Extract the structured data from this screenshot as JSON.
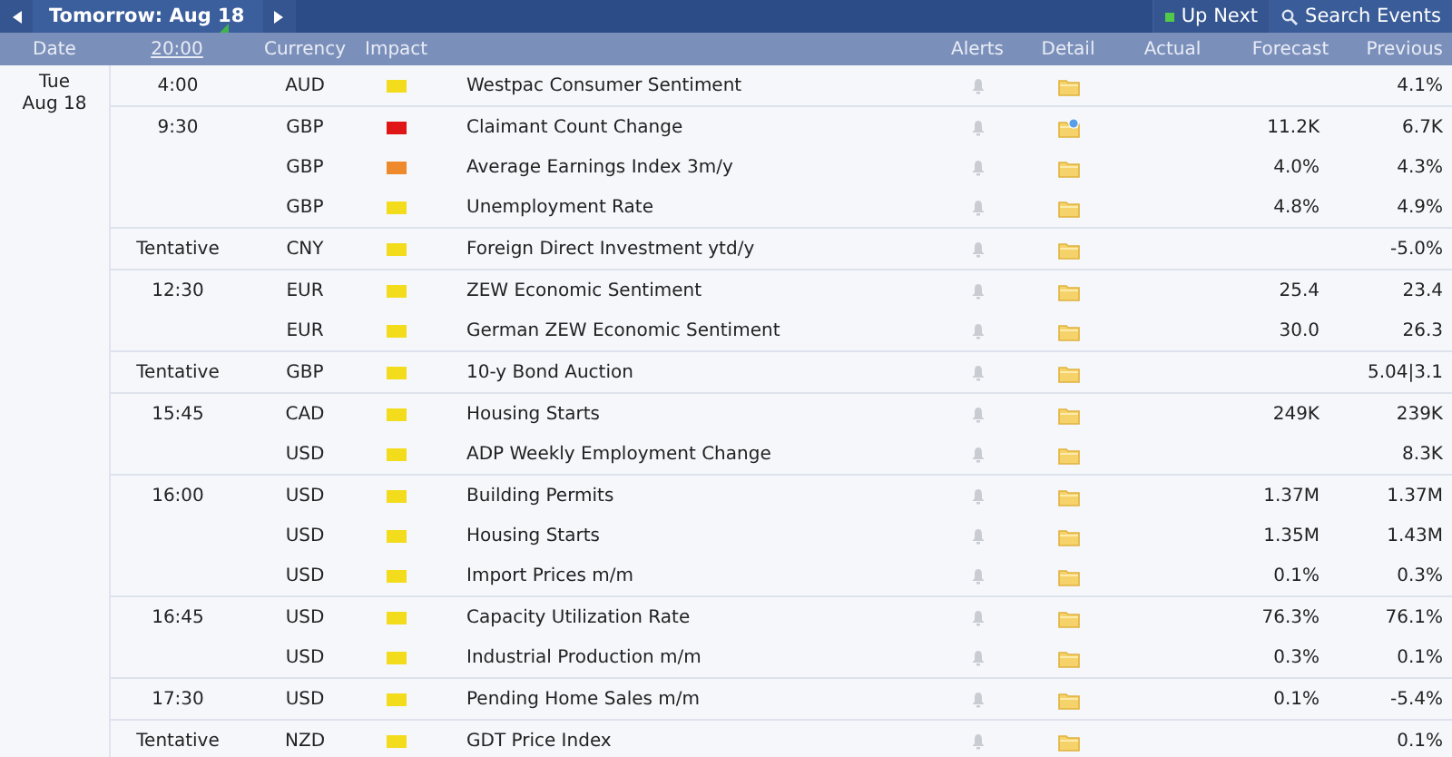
{
  "nav": {
    "title": "Tomorrow: Aug 18",
    "up_next": "Up Next",
    "search": "Search Events"
  },
  "columns": {
    "date": "Date",
    "time": "20:00",
    "currency": "Currency",
    "impact": "Impact",
    "alerts": "Alerts",
    "detail": "Detail",
    "actual": "Actual",
    "forecast": "Forecast",
    "previous": "Previous"
  },
  "day": {
    "weekday": "Tue",
    "date": "Aug 18"
  },
  "groups": [
    {
      "time": "4:00",
      "events": [
        {
          "currency": "AUD",
          "color": "#f3dc1c",
          "event": "Westpac Consumer Sentiment",
          "detail_updated": false,
          "previous": "4.1%"
        }
      ]
    },
    {
      "time": "9:30",
      "events": [
        {
          "currency": "GBP",
          "color": "#e01616",
          "event": "Claimant Count Change",
          "detail_updated": true,
          "forecast": "11.2K",
          "previous": "6.7K"
        },
        {
          "currency": "GBP",
          "color": "#ee8a2c",
          "event": "Average Earnings Index 3m/y",
          "detail_updated": false,
          "forecast": "4.0%",
          "previous": "4.3%"
        },
        {
          "currency": "GBP",
          "color": "#f3dc1c",
          "event": "Unemployment Rate",
          "detail_updated": false,
          "forecast": "4.8%",
          "previous": "4.9%"
        }
      ]
    },
    {
      "time": "Tentative",
      "events": [
        {
          "currency": "CNY",
          "color": "#f3dc1c",
          "event": "Foreign Direct Investment ytd/y",
          "detail_updated": false,
          "previous": "-5.0%"
        }
      ]
    },
    {
      "time": "12:30",
      "events": [
        {
          "currency": "EUR",
          "color": "#f3dc1c",
          "event": "ZEW Economic Sentiment",
          "detail_updated": false,
          "forecast": "25.4",
          "previous": "23.4"
        },
        {
          "currency": "EUR",
          "color": "#f3dc1c",
          "event": "German ZEW Economic Sentiment",
          "detail_updated": false,
          "forecast": "30.0",
          "previous": "26.3"
        }
      ]
    },
    {
      "time": "Tentative",
      "events": [
        {
          "currency": "GBP",
          "color": "#f3dc1c",
          "event": "10-y Bond Auction",
          "detail_updated": false,
          "previous": "5.04|3.1"
        }
      ]
    },
    {
      "time": "15:45",
      "events": [
        {
          "currency": "CAD",
          "color": "#f3dc1c",
          "event": "Housing Starts",
          "detail_updated": false,
          "forecast": "249K",
          "previous": "239K"
        },
        {
          "currency": "USD",
          "color": "#f3dc1c",
          "event": "ADP Weekly Employment Change",
          "detail_updated": false,
          "previous": "8.3K"
        }
      ]
    },
    {
      "time": "16:00",
      "events": [
        {
          "currency": "USD",
          "color": "#f3dc1c",
          "event": "Building Permits",
          "detail_updated": false,
          "forecast": "1.37M",
          "previous": "1.37M"
        },
        {
          "currency": "USD",
          "color": "#f3dc1c",
          "event": "Housing Starts",
          "detail_updated": false,
          "forecast": "1.35M",
          "previous": "1.43M"
        },
        {
          "currency": "USD",
          "color": "#f3dc1c",
          "event": "Import Prices m/m",
          "detail_updated": false,
          "forecast": "0.1%",
          "previous": "0.3%"
        }
      ]
    },
    {
      "time": "16:45",
      "events": [
        {
          "currency": "USD",
          "color": "#f3dc1c",
          "event": "Capacity Utilization Rate",
          "detail_updated": false,
          "forecast": "76.3%",
          "previous": "76.1%"
        },
        {
          "currency": "USD",
          "color": "#f3dc1c",
          "event": "Industrial Production m/m",
          "detail_updated": false,
          "forecast": "0.3%",
          "previous": "0.1%"
        }
      ]
    },
    {
      "time": "17:30",
      "events": [
        {
          "currency": "USD",
          "color": "#f3dc1c",
          "event": "Pending Home Sales m/m",
          "detail_updated": false,
          "forecast": "0.1%",
          "previous": "-5.4%"
        }
      ]
    },
    {
      "time": "Tentative",
      "events": [
        {
          "currency": "NZD",
          "color": "#f3dc1c",
          "event": "GDT Price Index",
          "detail_updated": false,
          "previous": "0.1%"
        }
      ]
    }
  ]
}
